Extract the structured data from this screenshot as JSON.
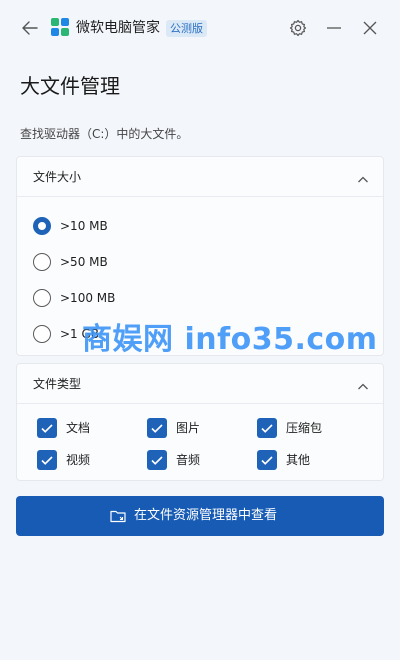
{
  "app": {
    "name": "微软电脑管家",
    "badge": "公测版"
  },
  "page": {
    "title": "大文件管理",
    "description": "查找驱动器（C:）中的大文件。"
  },
  "size_filter": {
    "title": "文件大小",
    "options": [
      {
        "label": ">10 MB",
        "checked": true
      },
      {
        "label": ">50 MB",
        "checked": false
      },
      {
        "label": ">100 MB",
        "checked": false
      },
      {
        "label": ">1 GB",
        "checked": false
      }
    ]
  },
  "type_filter": {
    "title": "文件类型",
    "options": [
      {
        "label": "文档",
        "checked": true
      },
      {
        "label": "图片",
        "checked": true
      },
      {
        "label": "压缩包",
        "checked": true
      },
      {
        "label": "视频",
        "checked": true
      },
      {
        "label": "音频",
        "checked": true
      },
      {
        "label": "其他",
        "checked": true
      }
    ]
  },
  "action": {
    "label": "在文件资源管理器中查看"
  },
  "watermark": "商娱网 info35.com",
  "colors": {
    "accent": "#1e63b8",
    "button": "#175bb5",
    "background": "#f3f7fc"
  }
}
